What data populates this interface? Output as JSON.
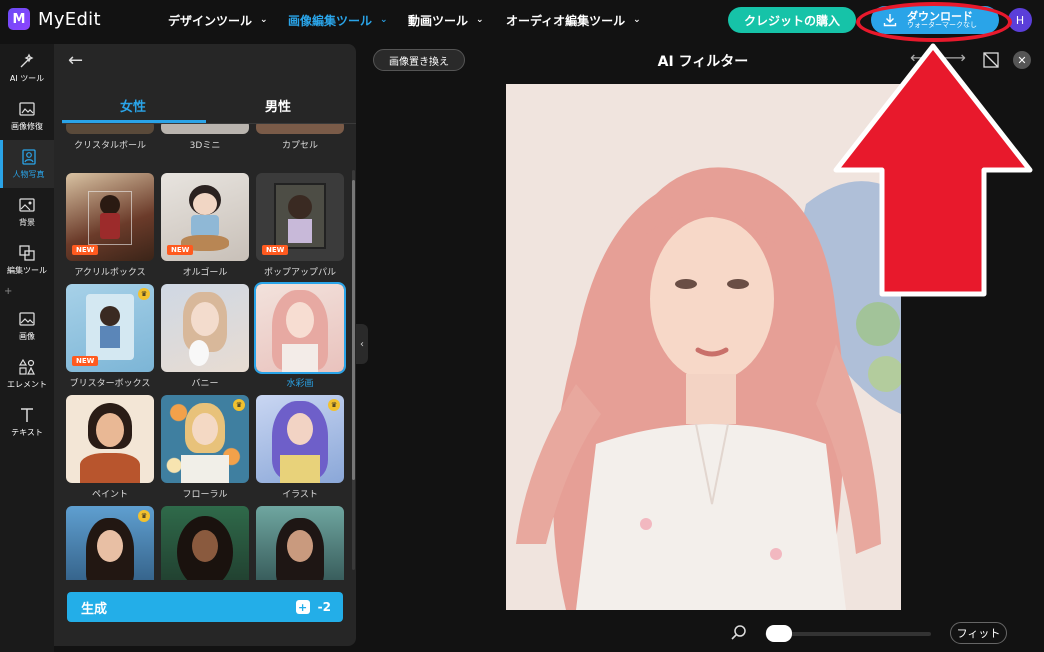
{
  "app": {
    "name": "MyEdit",
    "logo_letter": "M"
  },
  "nav": [
    {
      "label": "デザインツール"
    },
    {
      "label": "画像編集ツール",
      "active": true
    },
    {
      "label": "動画ツール"
    },
    {
      "label": "オーディオ編集ツール"
    }
  ],
  "header": {
    "credit_label": "クレジットの購入",
    "download_label": "ダウンロード",
    "download_sub": "ウォーターマークなし",
    "avatar_initial": "H"
  },
  "sidebar": {
    "items": [
      {
        "label": "AI ツール",
        "icon": "magic-wand-icon"
      },
      {
        "label": "画像修復",
        "icon": "image-repair-icon"
      },
      {
        "label": "人物写真",
        "icon": "portrait-icon",
        "active": true
      },
      {
        "label": "背景",
        "icon": "background-icon"
      },
      {
        "label": "編集ツール",
        "icon": "edit-tools-icon"
      },
      {
        "label": "画像",
        "icon": "image-icon"
      },
      {
        "label": "エレメント",
        "icon": "elements-icon"
      },
      {
        "label": "テキスト",
        "icon": "text-icon"
      }
    ]
  },
  "panel": {
    "tabs": [
      {
        "label": "女性",
        "active": true
      },
      {
        "label": "男性"
      }
    ],
    "partial_row": [
      "クリスタルボール",
      "3Dミニ",
      "カプセル"
    ],
    "styles": [
      {
        "label": "アクリルボックス",
        "new": true
      },
      {
        "label": "オルゴール",
        "new": true
      },
      {
        "label": "ポップアップパル",
        "new": true
      },
      {
        "label": "ブリスターボックス",
        "new": true,
        "premium": true
      },
      {
        "label": "バニー"
      },
      {
        "label": "水彩画",
        "selected": true
      },
      {
        "label": "ペイント"
      },
      {
        "label": "フローラル",
        "premium": true
      },
      {
        "label": "イラスト",
        "premium": true
      },
      {
        "label": "",
        "premium": true
      },
      {
        "label": ""
      },
      {
        "label": ""
      }
    ],
    "new_badge": "NEW",
    "generate_label": "生成",
    "generate_cost": "-2"
  },
  "canvas": {
    "replace_label": "画像置き換え",
    "title": "AI フィルター",
    "fit_label": "フィット",
    "zoom_level": 0.05
  },
  "colors": {
    "accent": "#2aa4e8",
    "credit": "#16c3a8",
    "annotation_red": "#e8192c"
  }
}
